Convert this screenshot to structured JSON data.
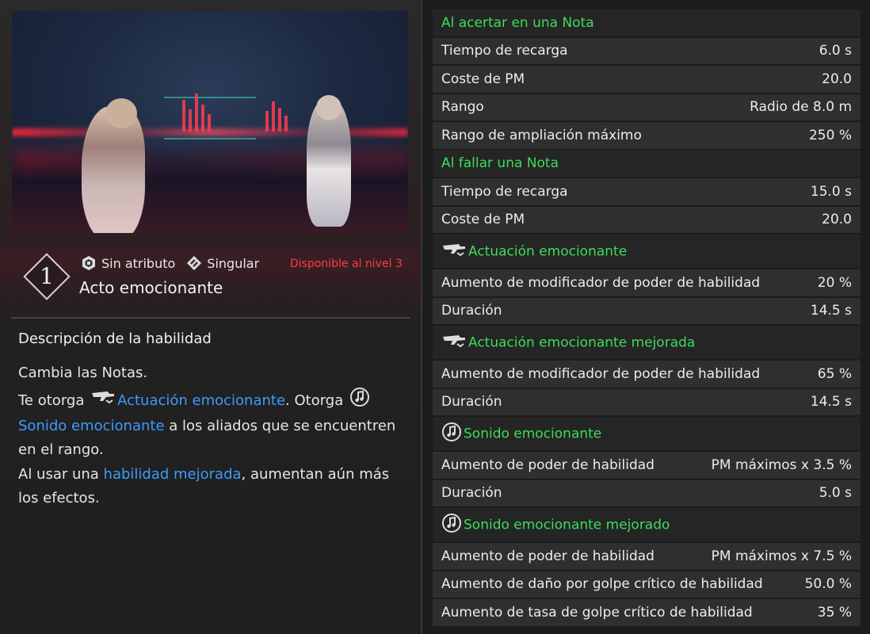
{
  "skill": {
    "level": "1",
    "attribute": "Sin atributo",
    "type": "Singular",
    "availability": "Disponible al nivel 3",
    "name": "Acto emocionante"
  },
  "description": {
    "title": "Descripción de la habilidad",
    "line1": "Cambia las Notas.",
    "p2_a": "Te otorga ",
    "p2_link1": "Actuación emocionante",
    "p2_b": ". Otorga ",
    "p2_link2": "Sonido emocionante",
    "p2_c": " a los aliados que se encuentren en el rango.",
    "p3_a": "Al usar una ",
    "p3_link": "habilidad mejorada",
    "p3_b": ", aumentan aún más los efectos."
  },
  "stats": {
    "hit_header": "Al acertar en una Nota",
    "hit": [
      {
        "k": "Tiempo de recarga",
        "v": "6.0 s"
      },
      {
        "k": "Coste de PM",
        "v": "20.0"
      },
      {
        "k": "Rango",
        "v": "Radio de 8.0 m"
      },
      {
        "k": "Rango de ampliación máximo",
        "v": "250 %"
      }
    ],
    "miss_header": "Al fallar una Nota",
    "miss": [
      {
        "k": "Tiempo de recarga",
        "v": "15.0 s"
      },
      {
        "k": "Coste de PM",
        "v": "20.0"
      }
    ],
    "perf_header": "Actuación emocionante",
    "perf": [
      {
        "k": "Aumento de modificador de poder de habilidad",
        "v": "20 %"
      },
      {
        "k": "Duración",
        "v": "14.5 s"
      }
    ],
    "perf_plus_header": "Actuación emocionante mejorada",
    "perf_plus": [
      {
        "k": "Aumento de modificador de poder de habilidad",
        "v": "65 %"
      },
      {
        "k": "Duración",
        "v": "14.5 s"
      }
    ],
    "sound_header": "Sonido emocionante",
    "sound": [
      {
        "k": "Aumento de poder de habilidad",
        "v": "PM máximos x 3.5 %"
      },
      {
        "k": "Duración",
        "v": "5.0 s"
      }
    ],
    "sound_plus_header": "Sonido emocionante mejorado",
    "sound_plus": [
      {
        "k": "Aumento de poder de habilidad",
        "v": "PM máximos x 7.5 %"
      },
      {
        "k": "Aumento de daño por golpe crítico de habilidad",
        "v": "50.0 %"
      },
      {
        "k": "Aumento de tasa de golpe crítico de habilidad",
        "v": "35 %"
      }
    ]
  },
  "colors": {
    "accent_green": "#3ddc5a",
    "link_blue": "#3d9bff",
    "warning_red": "#ff3b3b"
  },
  "icons": [
    "no-attribute-icon",
    "singular-icon",
    "gun-buff-icon",
    "music-note-icon"
  ]
}
